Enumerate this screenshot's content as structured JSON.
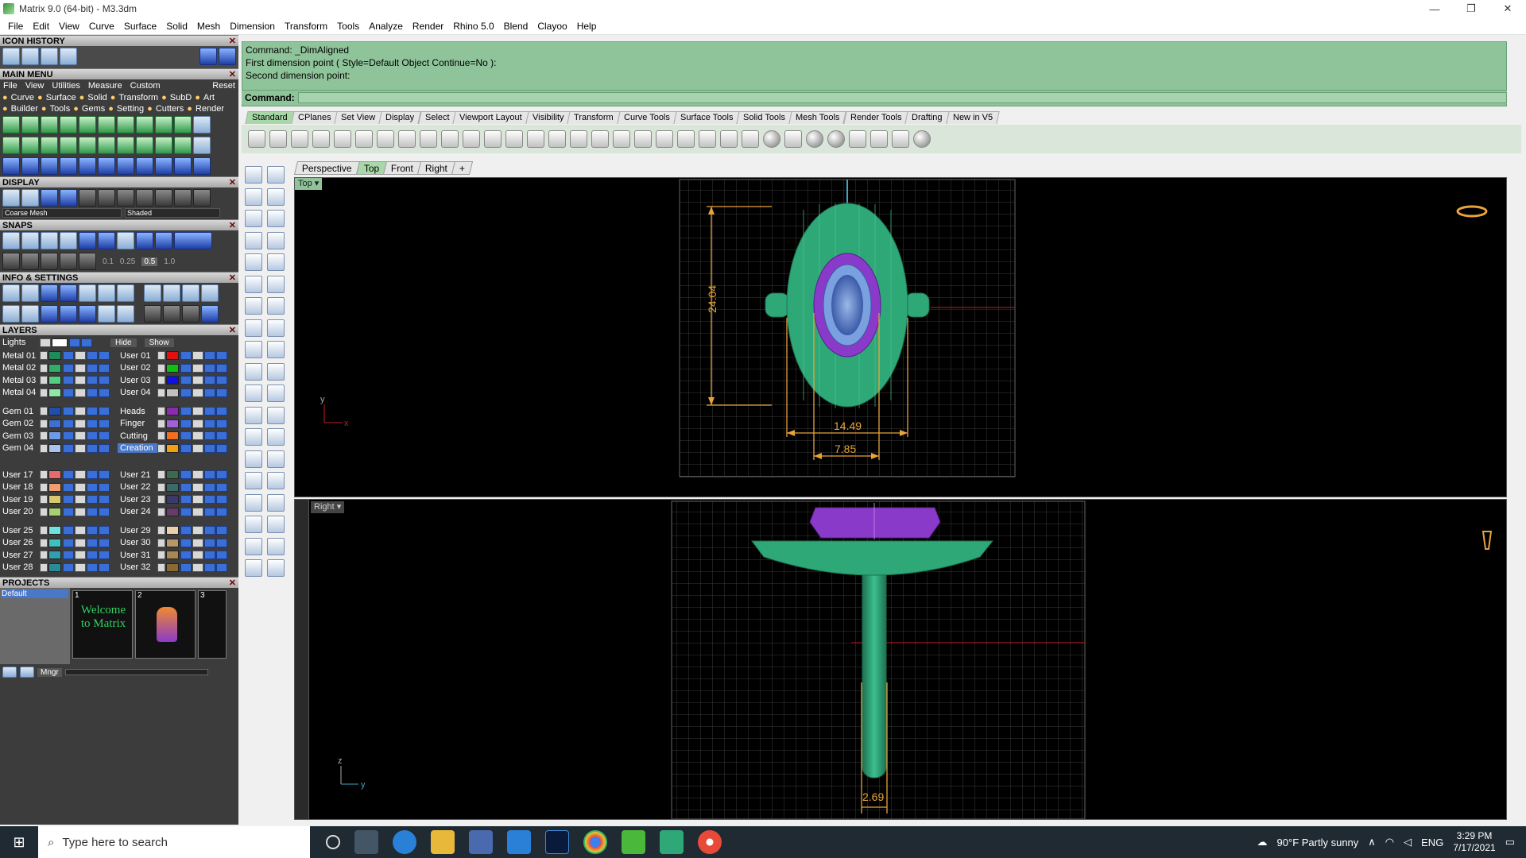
{
  "window": {
    "title": "Matrix 9.0 (64-bit) - M3.3dm",
    "controls": [
      "—",
      "❐",
      "✕"
    ]
  },
  "menubar": [
    "File",
    "Edit",
    "View",
    "Curve",
    "Surface",
    "Solid",
    "Mesh",
    "Dimension",
    "Transform",
    "Tools",
    "Analyze",
    "Render",
    "Rhino 5.0",
    "Blend",
    "Clayoo",
    "Help"
  ],
  "left": {
    "icon_history": "ICON HISTORY",
    "main_menu": "MAIN MENU",
    "main_menu_items": [
      "File",
      "View",
      "Utilities",
      "Measure",
      "Custom",
      "Reset"
    ],
    "main_menu_row2": [
      "Curve",
      "Surface",
      "Solid",
      "Transform",
      "SubD",
      "Art"
    ],
    "main_menu_row3": [
      "Builder",
      "Tools",
      "Gems",
      "Setting",
      "Cutters",
      "Render"
    ],
    "display": "DISPLAY",
    "display_mesh": "Coarse Mesh",
    "display_mode": "Shaded",
    "snaps": "SNAPS",
    "snap_values": [
      "0.1",
      "0.25",
      "0.5",
      "1.0"
    ],
    "info_settings": "INFO & SETTINGS",
    "layers": "LAYERS",
    "lights": "Lights",
    "hide": "Hide",
    "show": "Show",
    "layer_left": [
      {
        "name": "Metal 01",
        "color": "#1f8a5a"
      },
      {
        "name": "Metal 02",
        "color": "#2fae6a"
      },
      {
        "name": "Metal 03",
        "color": "#50d080"
      },
      {
        "name": "Metal 04",
        "color": "#90e8a8"
      },
      {
        "name": "Gem 01",
        "color": "#1f4fa8"
      },
      {
        "name": "Gem 02",
        "color": "#3f6fd0"
      },
      {
        "name": "Gem 03",
        "color": "#6f9ae8"
      },
      {
        "name": "Gem 04",
        "color": "#a8c4f0"
      },
      {
        "name": "User 17",
        "color": "#e86a6a"
      },
      {
        "name": "User 18",
        "color": "#f0a070"
      },
      {
        "name": "User 19",
        "color": "#d8c870"
      },
      {
        "name": "User 20",
        "color": "#a8d070"
      },
      {
        "name": "User 25",
        "color": "#70e0e0"
      },
      {
        "name": "User 26",
        "color": "#40c0c0"
      },
      {
        "name": "User 27",
        "color": "#30a0b0"
      },
      {
        "name": "User 28",
        "color": "#2a8a98"
      }
    ],
    "layer_right": [
      {
        "name": "User 01",
        "color": "#e01010"
      },
      {
        "name": "User 02",
        "color": "#10c010"
      },
      {
        "name": "User 03",
        "color": "#1010e0"
      },
      {
        "name": "User 04",
        "color": "#c0c0c0"
      },
      {
        "name": "Heads",
        "color": "#8a2ab0"
      },
      {
        "name": "Finger",
        "color": "#a060d8"
      },
      {
        "name": "Cutting",
        "color": "#f07020"
      },
      {
        "name": "Creation",
        "color": "#f0a010"
      },
      {
        "name": "User 21",
        "color": "#3a6a50"
      },
      {
        "name": "User 22",
        "color": "#3a6a6a"
      },
      {
        "name": "User 23",
        "color": "#3a3a6a"
      },
      {
        "name": "User 24",
        "color": "#6a3a6a"
      },
      {
        "name": "User 29",
        "color": "#e8d0a8"
      },
      {
        "name": "User 30",
        "color": "#b89868"
      },
      {
        "name": "User 31",
        "color": "#a88850"
      },
      {
        "name": "User 32",
        "color": "#8a6a30"
      }
    ],
    "projects": "PROJECTS",
    "project_default": "Default",
    "thumbs": [
      "1",
      "2",
      "3"
    ],
    "thumb_text": "Welcome to Matrix",
    "mngr": "Mngr"
  },
  "command": {
    "lines": [
      "Command: _DimAligned",
      "First dimension point ( Style=Default  Object  Continue=No ):",
      "Second dimension point:"
    ],
    "prompt": "Command:"
  },
  "toolbar_tabs": [
    "Standard",
    "CPlanes",
    "Set View",
    "Display",
    "Select",
    "Viewport Layout",
    "Visibility",
    "Transform",
    "Curve Tools",
    "Surface Tools",
    "Solid Tools",
    "Mesh Tools",
    "Render Tools",
    "Drafting",
    "New in V5"
  ],
  "viewport_tabs": [
    "Perspective",
    "Top",
    "Front",
    "Right"
  ],
  "viewport_top": {
    "label": "Top",
    "dim_vertical": "24.04",
    "dim_h1": "14.49",
    "dim_h2": "7.85",
    "axis_y": "y",
    "axis_x": "x"
  },
  "viewport_right": {
    "label": "Right",
    "dim": "2.69",
    "axis_z": "z",
    "axis_y": "y"
  },
  "taskbar": {
    "search": "Type here to search",
    "weather": "90°F  Partly sunny",
    "lang": "ENG",
    "time": "3:29 PM",
    "date": "7/17/2021"
  },
  "colors": {
    "gem_green": "#2fa878",
    "purple": "#8a3ac8",
    "dim": "#e8a43a",
    "grid": "#3a3a3a"
  }
}
